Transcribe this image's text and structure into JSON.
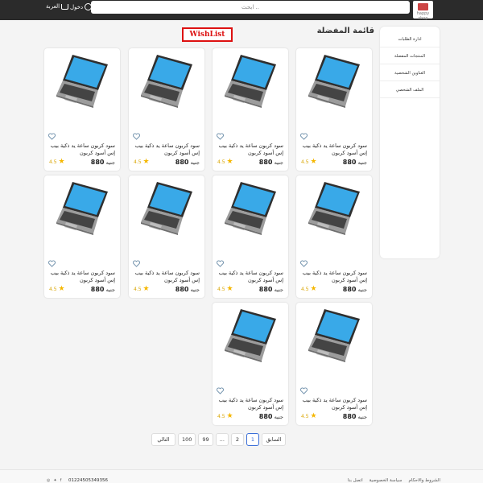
{
  "header": {
    "logo_text": "happy shop",
    "search_placeholder": "ابحث ..",
    "login_label": "دخول",
    "cart_label": "العربة"
  },
  "page": {
    "title": "قائمة المفضلة",
    "wishlist_badge": "WishList"
  },
  "sidebar": {
    "items": [
      {
        "label": "ادارة الطلبات"
      },
      {
        "label": "المنتجات المفضلة"
      },
      {
        "label": "العناوين الشخصية"
      },
      {
        "label": "الملف الشخصي"
      }
    ]
  },
  "products": [
    {
      "name": "سود كربون ساعة يد ذكية بيب إس أسود كربون",
      "rating": "4.5",
      "price": "880",
      "currency": "جنيه"
    },
    {
      "name": "سود كربون ساعة يد ذكية بيب إس أسود كربون",
      "rating": "4.5",
      "price": "880",
      "currency": "جنيه"
    },
    {
      "name": "سود كربون ساعة يد ذكية بيب إس أسود كربون",
      "rating": "4.5",
      "price": "880",
      "currency": "جنيه"
    },
    {
      "name": "سود كربون ساعة يد ذكية بيب إس أسود كربون",
      "rating": "4.5",
      "price": "880",
      "currency": "جنيه"
    },
    {
      "name": "سود كربون ساعة يد ذكية بيب إس أسود كربون",
      "rating": "4.5",
      "price": "880",
      "currency": "جنيه"
    },
    {
      "name": "سود كربون ساعة يد ذكية بيب إس أسود كربون",
      "rating": "4.5",
      "price": "880",
      "currency": "جنيه"
    },
    {
      "name": "سود كربون ساعة يد ذكية بيب إس أسود كربون",
      "rating": "4.5",
      "price": "880",
      "currency": "جنيه"
    },
    {
      "name": "سود كربون ساعة يد ذكية بيب إس أسود كربون",
      "rating": "4.5",
      "price": "880",
      "currency": "جنيه"
    },
    {
      "name": "سود كربون ساعة يد ذكية بيب إس أسود كربون",
      "rating": "4.5",
      "price": "880",
      "currency": "جنيه"
    },
    {
      "name": "سود كربون ساعة يد ذكية بيب إس أسود كربون",
      "rating": "4.5",
      "price": "880",
      "currency": "جنيه"
    }
  ],
  "pagination": {
    "next": "التالي",
    "pages": [
      "100",
      "99",
      "...",
      "2",
      "1"
    ],
    "prev": "السابق"
  },
  "footer": {
    "phone": "01224505349356",
    "links": [
      "الشروط والاحكام",
      "سياسة الخصوصية",
      "اتصل بنا"
    ]
  },
  "colors": {
    "topbar": "#2b2b2b",
    "accent": "#3b6fd8",
    "badge": "#dd1111",
    "star": "#f5b700"
  }
}
